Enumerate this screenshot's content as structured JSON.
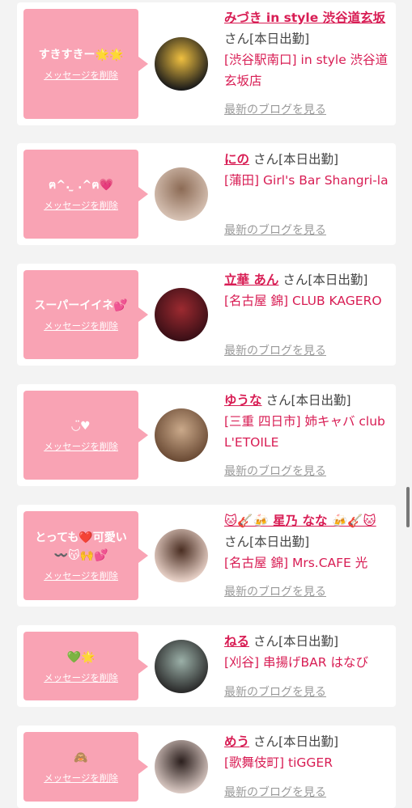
{
  "items": [
    {
      "message": "すきすきー🌟🌟",
      "delete_label": "メッセージを削除",
      "name": "みづき in style 渋谷道玄坂",
      "honorific": "さん",
      "status": "[本日出勤]",
      "shop": "[渋谷駅南口] in style 渋谷道玄坂店",
      "blog_link": "最新のブログを見る",
      "avatar_colors": [
        "#1a1a1a",
        "#f0c040"
      ]
    },
    {
      "message": "ฅ^. ̫ .^ฅ💗",
      "delete_label": "メッセージを削除",
      "name": "にの",
      "honorific": "さん",
      "status": "[本日出勤]",
      "shop": "[蒲田] Girl's Bar Shangri-la",
      "blog_link": "最新のブログを見る",
      "avatar_colors": [
        "#d7c2b4",
        "#8c6b55"
      ]
    },
    {
      "message": "スーパーイイネ💕",
      "delete_label": "メッセージを削除",
      "name": "立華 あん",
      "honorific": "さん",
      "status": "[本日出勤]",
      "shop": "[名古屋 錦] CLUB KAGERO",
      "blog_link": "最新のブログを見る",
      "avatar_colors": [
        "#3a0f16",
        "#9c2a30"
      ]
    },
    {
      "message": "◡̈♥",
      "delete_label": "メッセージを削除",
      "name": "ゆうな",
      "honorific": "さん",
      "status": "[本日出勤]",
      "shop": "[三重 四日市] 姉キャバ club L'ETOILE",
      "blog_link": "最新のブログを見る",
      "avatar_colors": [
        "#6b4b35",
        "#caa98a"
      ]
    },
    {
      "message": "とっても❤️可愛い 〰️😽🙌💕",
      "delete_label": "メッセージを削除",
      "name": "🐱🎸🍻 星乃 なな 🍻🎸🐱",
      "honorific": "さん",
      "status": "[本日出勤]",
      "shop": "[名古屋 錦] Mrs.CAFE 光",
      "blog_link": "最新のブログを見る",
      "avatar_colors": [
        "#e9d2c8",
        "#4a2e22"
      ]
    },
    {
      "message": "💚🌟",
      "delete_label": "メッセージを削除",
      "name": "ねる",
      "honorific": "さん",
      "status": "[本日出勤]",
      "shop": "[刈谷] 串揚げBAR はなび",
      "blog_link": "最新のブログを見る",
      "avatar_colors": [
        "#2a2a2a",
        "#9bb0a8"
      ]
    },
    {
      "message": "🙈",
      "delete_label": "メッセージを削除",
      "name": "めう",
      "honorific": "さん",
      "status": "[本日出勤]",
      "shop": "[歌舞伎町] tiGGER",
      "blog_link": "最新のブログを見る",
      "avatar_colors": [
        "#d9c8c2",
        "#2b1f1d"
      ]
    }
  ]
}
